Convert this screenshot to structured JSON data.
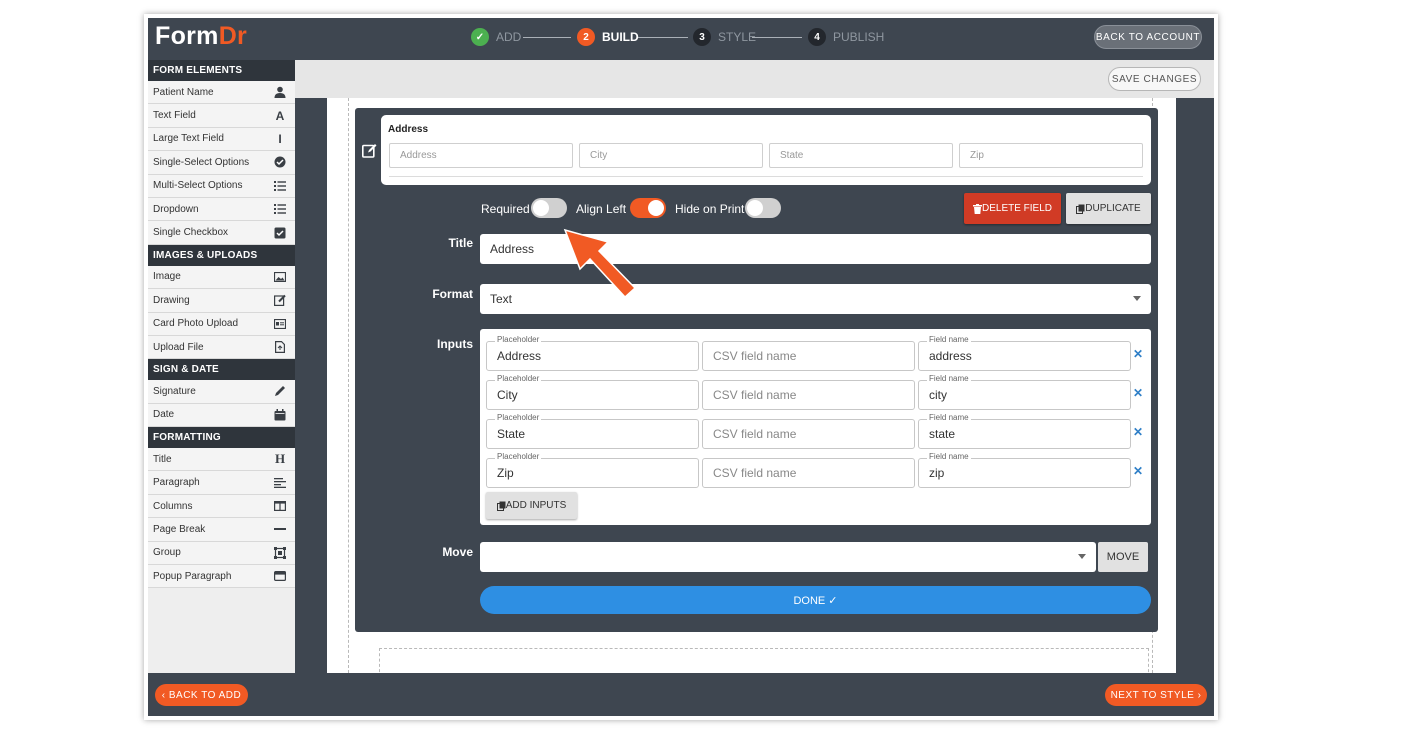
{
  "app": {
    "logo_main": "Form",
    "logo_accent": "Dr"
  },
  "steps": [
    {
      "num": "✓",
      "label": "ADD"
    },
    {
      "num": "2",
      "label": "BUILD"
    },
    {
      "num": "3",
      "label": "STYLE"
    },
    {
      "num": "4",
      "label": "PUBLISH"
    }
  ],
  "header": {
    "back_to_account": "BACK TO ACCOUNT",
    "save_changes": "SAVE CHANGES"
  },
  "sidebar": {
    "sections": [
      {
        "title": "FORM ELEMENTS",
        "items": [
          {
            "label": "Patient Name",
            "icon": "user-icon"
          },
          {
            "label": "Text Field",
            "icon": "font-icon"
          },
          {
            "label": "Large Text Field",
            "icon": "text-cursor-icon"
          },
          {
            "label": "Single-Select Options",
            "icon": "check-circle-icon"
          },
          {
            "label": "Multi-Select Options",
            "icon": "list-icon"
          },
          {
            "label": "Dropdown",
            "icon": "list-icon"
          },
          {
            "label": "Single Checkbox",
            "icon": "checkbox-icon"
          }
        ]
      },
      {
        "title": "IMAGES & UPLOADS",
        "items": [
          {
            "label": "Image",
            "icon": "image-icon"
          },
          {
            "label": "Drawing",
            "icon": "edit-icon"
          },
          {
            "label": "Card Photo Upload",
            "icon": "id-card-icon"
          },
          {
            "label": "Upload File",
            "icon": "file-icon"
          }
        ]
      },
      {
        "title": "SIGN & DATE",
        "items": [
          {
            "label": "Signature",
            "icon": "pen-icon"
          },
          {
            "label": "Date",
            "icon": "calendar-icon"
          }
        ]
      },
      {
        "title": "FORMATTING",
        "items": [
          {
            "label": "Title",
            "icon": "heading-icon"
          },
          {
            "label": "Paragraph",
            "icon": "align-left-icon"
          },
          {
            "label": "Columns",
            "icon": "columns-icon"
          },
          {
            "label": "Page Break",
            "icon": "minus-icon"
          },
          {
            "label": "Group",
            "icon": "object-group-icon"
          },
          {
            "label": "Popup Paragraph",
            "icon": "window-icon"
          }
        ]
      }
    ]
  },
  "preview": {
    "title": "Address",
    "placeholders": [
      "Address",
      "City",
      "State",
      "Zip"
    ]
  },
  "toggles": {
    "required": {
      "label": "Required",
      "on": false
    },
    "align_left": {
      "label": "Align Left",
      "on": true
    },
    "hide_on_print": {
      "label": "Hide on Print",
      "on": false
    }
  },
  "actions": {
    "delete": "DELETE FIELD",
    "duplicate": "DUPLICATE"
  },
  "editor": {
    "title_label": "Title",
    "title_value": "Address",
    "format_label": "Format",
    "format_value": "Text",
    "inputs_label": "Inputs",
    "placeholder_label": "Placeholder",
    "csv_placeholder": "CSV field name",
    "fieldname_label": "Field name",
    "inputs": [
      {
        "placeholder": "Address",
        "field_name": "address"
      },
      {
        "placeholder": "City",
        "field_name": "city"
      },
      {
        "placeholder": "State",
        "field_name": "state"
      },
      {
        "placeholder": "Zip",
        "field_name": "zip"
      }
    ],
    "add_inputs": "ADD INPUTS",
    "move_label": "Move",
    "move_value": "",
    "move_button": "MOVE",
    "done": "DONE ✓"
  },
  "footer": {
    "back_to_add": "‹ BACK TO ADD",
    "next_to_style": "NEXT TO STYLE ›"
  },
  "colors": {
    "accent": "#f15a24",
    "dark": "#3e4650",
    "done_blue": "#2e8fe3",
    "delete_red": "#d13b25",
    "step_done": "#4cb050"
  }
}
